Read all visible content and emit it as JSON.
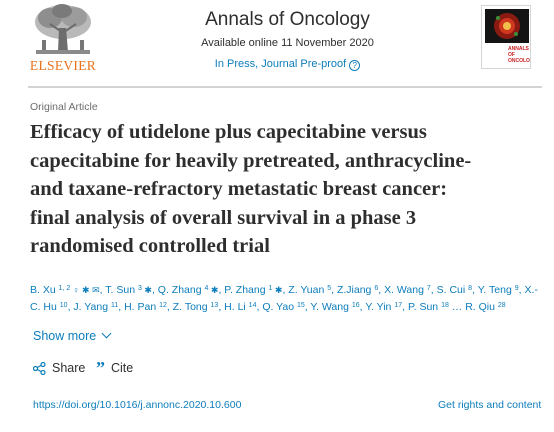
{
  "publisher": {
    "name": "ELSEVIER"
  },
  "journal": {
    "title": "Annals of Oncology",
    "availability": "Available online 11 November 2020",
    "status": "In Press, Journal Pre-proof",
    "help_icon": "?",
    "cover_label": "ANNALS OF ONCOLOGY"
  },
  "article": {
    "type": "Original Article",
    "title_lines": [
      "Efficacy of utidelone plus capecitabine versus",
      "capecitabine for heavily pretreated, anthracycline-",
      "and taxane-refractory metastatic breast cancer:",
      "final analysis of overall survival in a phase 3",
      "randomised controlled trial"
    ],
    "authors": [
      {
        "name": "B. Xu",
        "sup": "1, 2",
        "icons": "♀ ✱ ✉"
      },
      {
        "name": "T. Sun",
        "sup": "3",
        "icons": "✱"
      },
      {
        "name": "Q. Zhang",
        "sup": "4",
        "icons": "✱"
      },
      {
        "name": "P. Zhang",
        "sup": "1",
        "icons": "✱"
      },
      {
        "name": "Z. Yuan",
        "sup": "5",
        "icons": ""
      },
      {
        "name": "Z.Jiang",
        "sup": "6",
        "icons": ""
      },
      {
        "name": "X. Wang",
        "sup": "7",
        "icons": ""
      },
      {
        "name": "S. Cui",
        "sup": "8",
        "icons": ""
      },
      {
        "name": "Y. Teng",
        "sup": "9",
        "icons": ""
      },
      {
        "name": "X.-C. Hu",
        "sup": "10",
        "icons": ""
      },
      {
        "name": "J. Yang",
        "sup": "11",
        "icons": ""
      },
      {
        "name": "H. Pan",
        "sup": "12",
        "icons": ""
      },
      {
        "name": "Z. Tong",
        "sup": "13",
        "icons": ""
      },
      {
        "name": "H. Li",
        "sup": "14",
        "icons": ""
      },
      {
        "name": "Q. Yao",
        "sup": "15",
        "icons": ""
      },
      {
        "name": "Y. Wang",
        "sup": "16",
        "icons": ""
      },
      {
        "name": "Y. Yin",
        "sup": "17",
        "icons": ""
      },
      {
        "name": "P. Sun",
        "sup": "18",
        "icons": ""
      },
      {
        "name": "R. Qiu",
        "sup": "28",
        "icons": ""
      }
    ],
    "authors_ellipsis": "…"
  },
  "actions": {
    "show_more": "Show more",
    "share": "Share",
    "cite": "Cite"
  },
  "links": {
    "doi": "https://doi.org/10.1016/j.annonc.2020.10.600",
    "rights": "Get rights and content"
  },
  "colors": {
    "link": "#0c7dbb",
    "elsevier_orange": "#e9711c",
    "text": "#2e2e2e"
  }
}
